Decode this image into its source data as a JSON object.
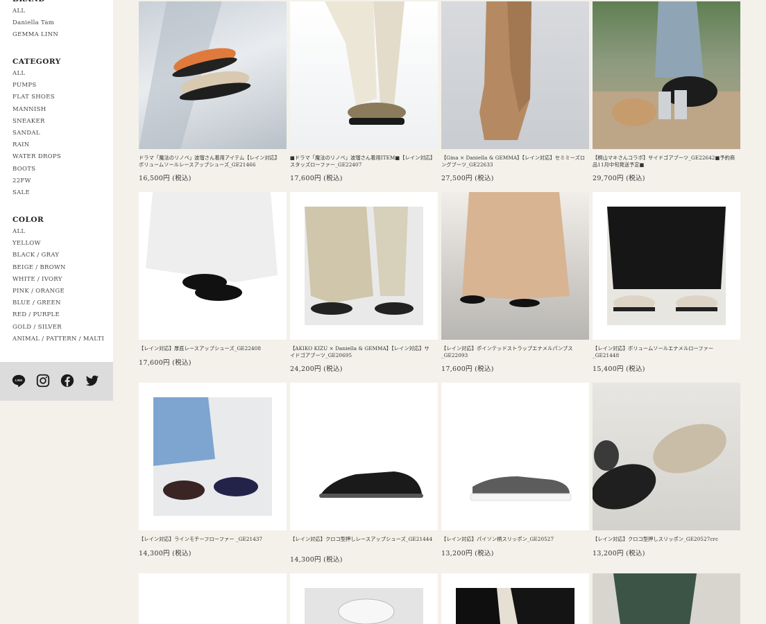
{
  "sidebar": {
    "brand": {
      "title": "BRAND",
      "items": [
        "ALL",
        "Daniella Tam",
        "GEMMA LINN"
      ]
    },
    "category": {
      "title": "CATEGORY",
      "items": [
        "ALL",
        "PUMPS",
        "FLAT SHOES",
        "MANNISH",
        "SNEAKER",
        "SANDAL",
        "RAIN",
        "WATER DROPS",
        "BOOTS",
        "22FW",
        "SALE"
      ]
    },
    "color": {
      "title": "COLOR",
      "items": [
        "ALL",
        "YELLOW",
        "BLACK / GRAY",
        "BEIGE / BROWN",
        "WHITE / IVORY",
        "PINK / ORANGE",
        "BLUE / GREEN",
        "RED / PURPLE",
        "GOLD / SILVER",
        "ANIMAL / PATTERN / MALTI"
      ]
    }
  },
  "social": [
    "line-icon",
    "instagram-icon",
    "facebook-icon",
    "twitter-icon"
  ],
  "products": [
    {
      "name": "ドラマ「魔法のリノベ」波瑠さん着用アイテム【レイン対応】ボリュームソールレースアップシューズ_GE21466",
      "price": "16,500円 (税込)"
    },
    {
      "name": "■ドラマ「魔法のリノベ」波瑠さん着用ITEM■【レイン対応】スタッズローファー_GE22407",
      "price": "17,600円 (税込)"
    },
    {
      "name": "【Gina × Daniella & GEMMA】【レイン対応】セミミーズロングブーツ_GE22633",
      "price": "27,500円 (税込)"
    },
    {
      "name": "【桐山マキさんコラボ】サイドゴアブーツ_GE22642■予約商品11月中旬発送予定■",
      "price": "29,700円 (税込)"
    },
    {
      "name": "【レイン対応】厚底レースアップシューズ_GE22408",
      "price": "17,600円 (税込)"
    },
    {
      "name": "【AKIKO KIZU × Daniella & GEMMA】【レイン対応】サイドゴアブーツ_GE20695",
      "price": "24,200円 (税込)"
    },
    {
      "name": "【レイン対応】ポインテッドストラップエナメルパンプス_GE22093",
      "price": "17,600円 (税込)"
    },
    {
      "name": "【レイン対応】ボリュームソールエナメルローファー_GE21448",
      "price": "15,400円 (税込)"
    },
    {
      "name": "【レイン対応】ラインモチーフローファー _GE21437",
      "price": "14,300円 (税込)"
    },
    {
      "name": "【レイン対応】クロコ型押しレースアップシューズ_GE21444",
      "price": "14,300円 (税込)"
    },
    {
      "name": "【レイン対応】パイソン柄スリッポン_GE20527",
      "price": "13,200円 (税込)"
    },
    {
      "name": "【レイン対応】クロコ型押しスリッポン_GE20527crc",
      "price": "13,200円 (税込)"
    },
    {
      "name": "",
      "price": ""
    },
    {
      "name": "",
      "price": ""
    },
    {
      "name": "",
      "price": ""
    },
    {
      "name": "",
      "price": ""
    }
  ]
}
